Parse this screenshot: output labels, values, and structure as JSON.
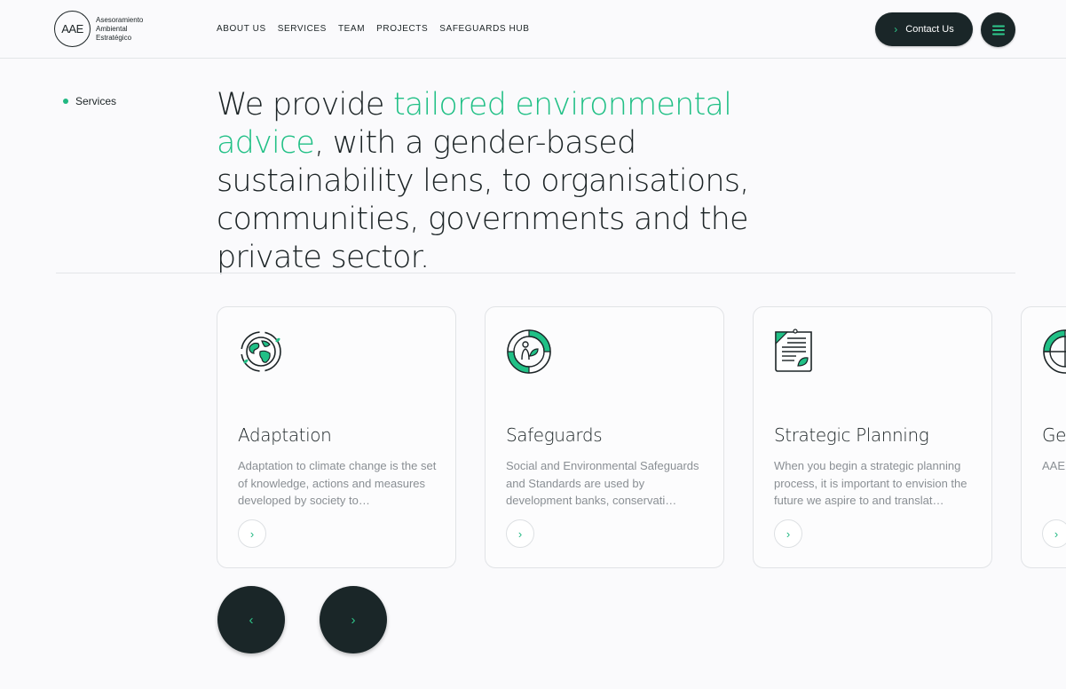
{
  "header": {
    "logo_mark": "AAE",
    "logo_lines": [
      "Asesoramiento",
      "Ambiental",
      "Estratégico"
    ],
    "nav": [
      "ABOUT US",
      "SERVICES",
      "TEAM",
      "PROJECTS",
      "SAFEGUARDS HUB"
    ],
    "contact_label": "Contact Us"
  },
  "intro": {
    "section_label": "Services",
    "headline_pre": "We provide ",
    "headline_accent": "tailored environmental advice",
    "headline_post": ", with a gender-based sustainability lens, to organisations, communities, governments and the private sector."
  },
  "cards": [
    {
      "title": "Adaptation",
      "description": "Adaptation to climate change is the set of knowledge, actions and measures developed by society to…",
      "icon": "globe-icon"
    },
    {
      "title": "Safeguards",
      "description": "Social and Environmental Safeguards and Standards are used by development banks, conservati…",
      "icon": "safeguards-icon"
    },
    {
      "title": "Strategic Planning",
      "description": "When you begin a strategic planning process, it is important to envision the future we aspire to and translat…",
      "icon": "document-leaf-icon"
    },
    {
      "title": "Ge",
      "description": "AAE with pers",
      "icon": "gender-icon"
    }
  ],
  "colors": {
    "accent": "#21c086",
    "dark": "#1a2628",
    "muted_text": "#8a8f94"
  }
}
